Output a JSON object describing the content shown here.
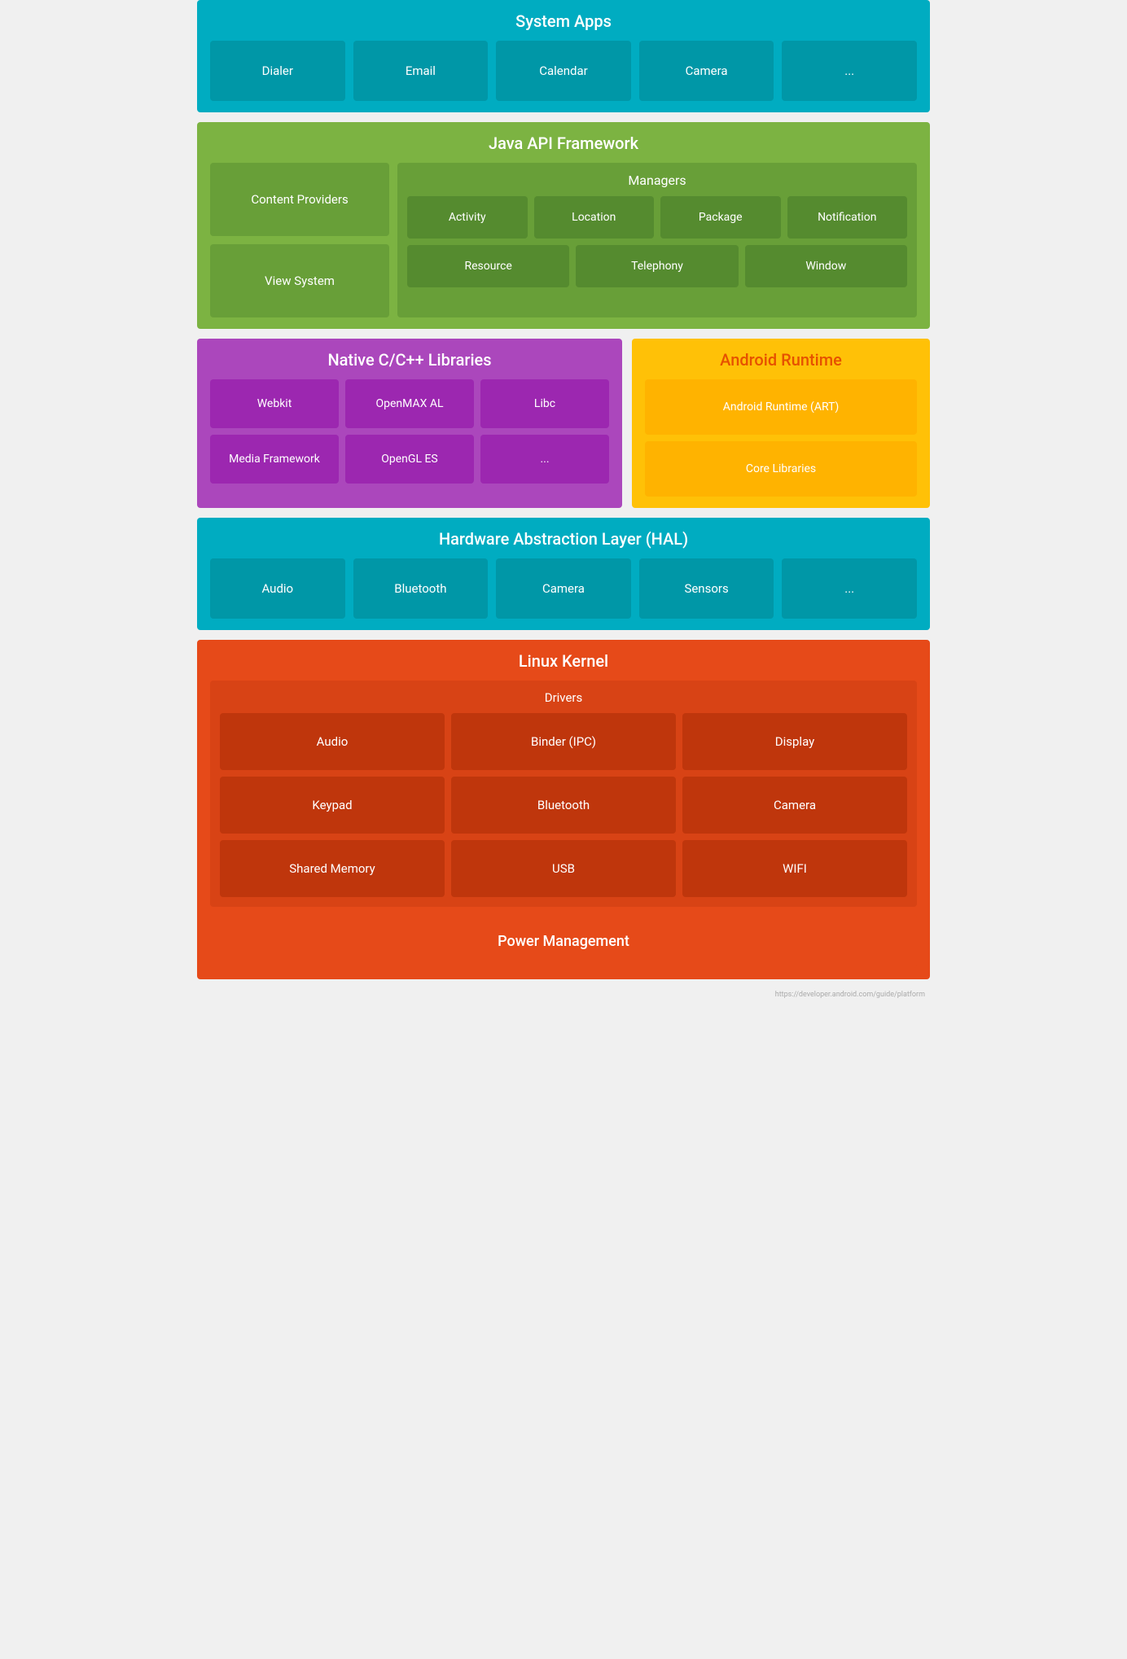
{
  "system_apps": {
    "title": "System Apps",
    "items": [
      "Dialer",
      "Email",
      "Calendar",
      "Camera",
      "..."
    ]
  },
  "java_api": {
    "title": "Java API Framework",
    "left": {
      "items": [
        "Content Providers",
        "View System"
      ]
    },
    "right": {
      "title": "Managers",
      "rows": [
        [
          "Activity",
          "Location",
          "Package",
          "Notification"
        ],
        [
          "Resource",
          "Telephony",
          "Window"
        ]
      ]
    }
  },
  "native_libs": {
    "title": "Native C/C++ Libraries",
    "rows": [
      [
        "Webkit",
        "OpenMAX AL",
        "Libc"
      ],
      [
        "Media Framework",
        "OpenGL ES",
        "..."
      ]
    ]
  },
  "android_runtime": {
    "title": "Android Runtime",
    "items": [
      "Android Runtime (ART)",
      "Core Libraries"
    ]
  },
  "hal": {
    "title": "Hardware Abstraction Layer (HAL)",
    "items": [
      "Audio",
      "Bluetooth",
      "Camera",
      "Sensors",
      "..."
    ]
  },
  "linux_kernel": {
    "title": "Linux Kernel",
    "drivers": {
      "title": "Drivers",
      "rows": [
        [
          "Audio",
          "Binder (IPC)",
          "Display"
        ],
        [
          "Keypad",
          "Bluetooth",
          "Camera"
        ],
        [
          "Shared Memory",
          "USB",
          "WIFI"
        ]
      ]
    },
    "power_management": "Power Management"
  },
  "watermark": "https://developer.android.com/guide/platform"
}
